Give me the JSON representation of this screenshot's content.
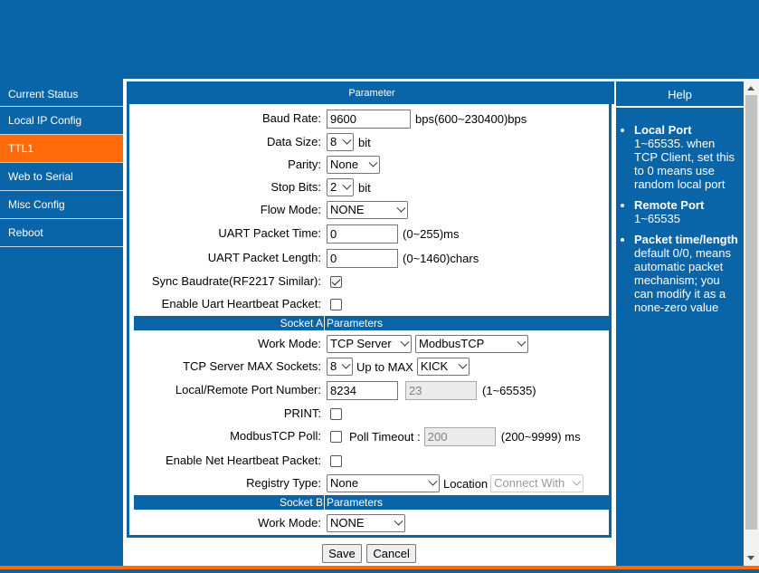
{
  "nav": {
    "items": [
      {
        "label": "Current Status"
      },
      {
        "label": "Local IP Config"
      },
      {
        "label": "TTL1",
        "active": true
      },
      {
        "label": "Web to Serial"
      },
      {
        "label": "Misc Config"
      },
      {
        "label": "Reboot"
      }
    ]
  },
  "panel": {
    "title": "Parameter",
    "baud_rate": {
      "label": "Baud Rate:",
      "value": "9600",
      "unit": "bps(600~230400)bps"
    },
    "data_size": {
      "label": "Data Size:",
      "value": "8",
      "unit": "bit"
    },
    "parity": {
      "label": "Parity:",
      "value": "None"
    },
    "stop_bits": {
      "label": "Stop Bits:",
      "value": "2",
      "unit": "bit"
    },
    "flow_mode": {
      "label": "Flow Mode:",
      "value": "NONE"
    },
    "uart_packet_time": {
      "label": "UART Packet Time:",
      "value": "0",
      "unit": "(0~255)ms"
    },
    "uart_packet_length": {
      "label": "UART Packet Length:",
      "value": "0",
      "unit": "(0~1460)chars"
    },
    "sync_baudrate": {
      "label": "Sync Baudrate(RF2217 Similar):",
      "checked": true
    },
    "uart_heartbeat": {
      "label": "Enable Uart Heartbeat Packet:",
      "checked": false
    },
    "socket_a": {
      "header_left": "Socket A",
      "header_right": "Parameters",
      "work_mode": {
        "label": "Work Mode:",
        "value": "TCP Server",
        "protocol": "ModbusTCP"
      },
      "max_sockets": {
        "label": "TCP Server MAX Sockets:",
        "value": "8",
        "up_to_label": "Up to MAX",
        "up_to_value": "KICK"
      },
      "port_number": {
        "label": "Local/Remote Port Number:",
        "local": "8234",
        "remote": "23",
        "range": "(1~65535)"
      },
      "print": {
        "label": "PRINT:",
        "checked": false
      },
      "modbus_poll": {
        "label": "ModbusTCP Poll:",
        "checked": false,
        "timeout_label": "Poll Timeout :",
        "timeout_value": "200",
        "timeout_range": "(200~9999) ms"
      },
      "net_heartbeat": {
        "label": "Enable Net Heartbeat Packet:",
        "checked": false
      },
      "registry_type": {
        "label": "Registry Type:",
        "value": "None",
        "location_label": "Location",
        "location_value": "Connect With"
      }
    },
    "socket_b": {
      "header_left": "Socket B",
      "header_right": "Parameters",
      "work_mode": {
        "label": "Work Mode:",
        "value": "NONE"
      }
    }
  },
  "buttons": {
    "save": "Save",
    "cancel": "Cancel"
  },
  "help": {
    "title": "Help",
    "items": [
      {
        "heading": "Local Port",
        "text": "1~65535. when TCP Client, set this to 0 means use random local port"
      },
      {
        "heading": "Remote Port",
        "text": "1~65535"
      },
      {
        "heading": "Packet time/length",
        "text": "default 0/0, means automatic packet mechanism; you can modify it as a none-zero value"
      }
    ]
  },
  "colors": {
    "brand_blue": "#0a64a8",
    "active_orange": "#ff6a0a"
  }
}
